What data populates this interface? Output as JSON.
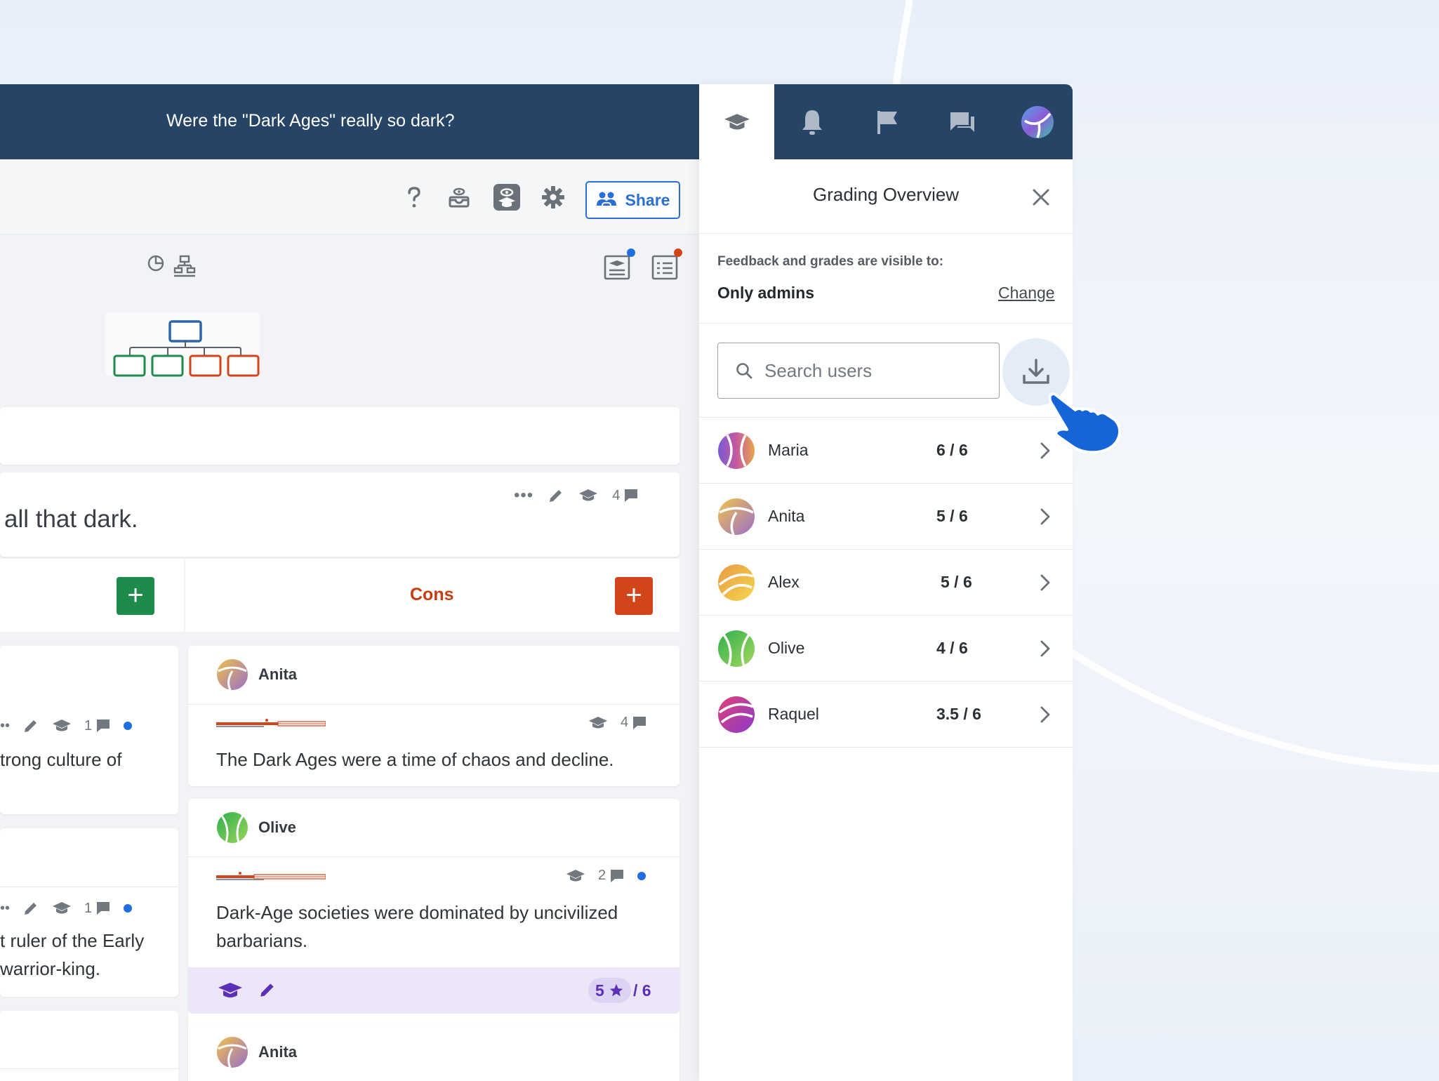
{
  "app": {
    "title": "Were the \"Dark Ages\" really so dark?",
    "share_label": "Share"
  },
  "thesis": {
    "text": "all that dark.",
    "comment_count": "4"
  },
  "columns": {
    "cons_label": "Cons",
    "plus_symbol": "+"
  },
  "left_cards": [
    {
      "comment_count": "1",
      "text": "trong culture of"
    },
    {
      "comment_count": "1",
      "text_line1": "t ruler of the Early",
      "text_line2": "warrior-king."
    }
  ],
  "cons_cards": [
    {
      "author": "Anita",
      "comment_count": "4",
      "text": "The Dark Ages were a time of chaos and decline."
    },
    {
      "author": "Olive",
      "comment_count": "2",
      "text_line1": "Dark-Age societies were dominated by uncivilized",
      "text_line2": "barbarians.",
      "grade": "5",
      "grade_total": "/ 6"
    },
    {
      "author": "Anita"
    }
  ],
  "panel": {
    "title": "Grading Overview",
    "visibility_label": "Feedback and grades are visible to:",
    "visibility_value": "Only admins",
    "change_label": "Change",
    "search_placeholder": "Search users",
    "users": [
      {
        "name": "Maria",
        "score": "6 / 6"
      },
      {
        "name": "Anita",
        "score": "5 / 6"
      },
      {
        "name": "Alex",
        "score": "5 / 6"
      },
      {
        "name": "Olive",
        "score": "4 / 6"
      },
      {
        "name": "Raquel",
        "score": "3.5 / 6"
      }
    ]
  },
  "colors": {
    "header_bg": "#264465",
    "accent_blue": "#2a6fd6",
    "pro_green": "#1e8a4c",
    "con_red": "#d2451a",
    "grade_purple": "#5b2fb8"
  },
  "icons": [
    "help-icon",
    "inbox-icon",
    "guided-icon",
    "gear-icon",
    "share-users-icon",
    "graduation-cap-icon",
    "bell-icon",
    "flag-icon",
    "chat-icon",
    "logo-icon",
    "close-icon",
    "search-icon",
    "download-icon",
    "chevron-right-icon",
    "pencil-icon",
    "more-icon",
    "comment-icon",
    "star-icon",
    "hand-pointer-icon"
  ]
}
